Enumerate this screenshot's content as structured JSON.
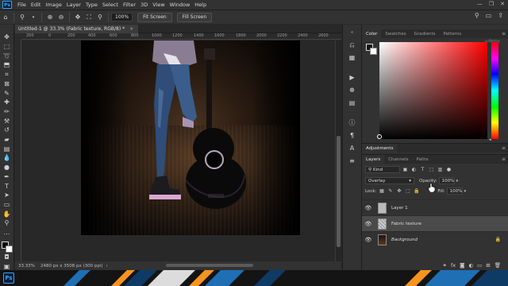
{
  "app": {
    "logo_text": "Ps",
    "menu": [
      "File",
      "Edit",
      "Image",
      "Layer",
      "Type",
      "Select",
      "Filter",
      "3D",
      "View",
      "Window",
      "Help"
    ],
    "window_controls": [
      "—",
      "❐",
      "✕"
    ]
  },
  "options_bar": {
    "zoom_value": "100%",
    "fit_screen_label": "Fit Screen",
    "fill_screen_label": "Fill Screen"
  },
  "document": {
    "tab_title": "Untitled-1 @ 33.3% (Fabric texture, RGB/8) *",
    "tab_close": "×",
    "ruler_labels": [
      "200",
      "0",
      "200",
      "400",
      "600",
      "800",
      "1000",
      "1200",
      "1400",
      "1600",
      "1800",
      "2000",
      "2200",
      "2400",
      "2600"
    ]
  },
  "status": {
    "zoom": "33.33%",
    "dimensions": "2480 px x 3508 px (300 ppi)"
  },
  "color_panel": {
    "tabs": [
      "Color",
      "Swatches",
      "Gradients",
      "Patterns"
    ],
    "active_tab": "Color",
    "foreground_color": "#111111",
    "background_color": "#ffffff",
    "picker_hue": "#ff0000"
  },
  "adjustments": {
    "title": "Adjustments"
  },
  "layers_panel": {
    "tabs": [
      "Layers",
      "Channels",
      "Paths"
    ],
    "active_tab": "Layers",
    "kind_filter": "Kind",
    "blend_mode": "Overlay",
    "opacity_label": "Opacity:",
    "opacity_value": "100%",
    "lock_label": "Lock:",
    "fill_label": "Fill:",
    "fill_value": "100%",
    "layers": [
      {
        "name": "Layer 1",
        "visible": true,
        "selected": false,
        "locked": false
      },
      {
        "name": "Fabric texture",
        "visible": true,
        "selected": true,
        "locked": false
      },
      {
        "name": "Background",
        "visible": true,
        "selected": false,
        "locked": true
      }
    ]
  },
  "watermark": "udemy",
  "colors": {
    "accent": "#31a8ff",
    "panel": "#323232",
    "workspace": "#282828",
    "taskbar_stripe_orange": "#f7941d",
    "taskbar_stripe_blue": "#1f6fb5"
  }
}
